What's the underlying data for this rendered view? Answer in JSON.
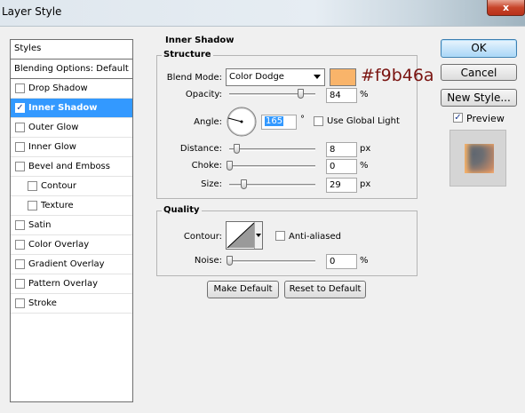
{
  "window": {
    "title": "Layer Style",
    "close_glyph": "x"
  },
  "sidebar": {
    "header": "Styles",
    "blending_options": "Blending Options: Default",
    "items": [
      {
        "label": "Drop Shadow",
        "checked": false,
        "selected": false
      },
      {
        "label": "Inner Shadow",
        "checked": true,
        "selected": true
      },
      {
        "label": "Outer Glow",
        "checked": false,
        "selected": false
      },
      {
        "label": "Inner Glow",
        "checked": false,
        "selected": false
      },
      {
        "label": "Bevel and Emboss",
        "checked": false,
        "selected": false
      },
      {
        "label": "Contour",
        "checked": false,
        "selected": false,
        "indent": true
      },
      {
        "label": "Texture",
        "checked": false,
        "selected": false,
        "indent": true
      },
      {
        "label": "Satin",
        "checked": false,
        "selected": false
      },
      {
        "label": "Color Overlay",
        "checked": false,
        "selected": false
      },
      {
        "label": "Gradient Overlay",
        "checked": false,
        "selected": false
      },
      {
        "label": "Pattern Overlay",
        "checked": false,
        "selected": false
      },
      {
        "label": "Stroke",
        "checked": false,
        "selected": false
      }
    ]
  },
  "inner_shadow": {
    "section_title": "Inner Shadow",
    "structure_title": "Structure",
    "blend_mode_label": "Blend Mode:",
    "blend_mode_value": "Color Dodge",
    "color_swatch": "#f9b46a",
    "color_annotation": "#f9b46a",
    "opacity_label": "Opacity:",
    "opacity_value": "84",
    "opacity_unit": "%",
    "angle_label": "Angle:",
    "angle_value": "165",
    "angle_unit": "°",
    "use_global_light_label": "Use Global Light",
    "use_global_light_checked": false,
    "distance_label": "Distance:",
    "distance_value": "8",
    "distance_unit": "px",
    "choke_label": "Choke:",
    "choke_value": "0",
    "choke_unit": "%",
    "size_label": "Size:",
    "size_value": "29",
    "size_unit": "px"
  },
  "quality": {
    "title": "Quality",
    "contour_label": "Contour:",
    "anti_aliased_label": "Anti-aliased",
    "anti_aliased_checked": false,
    "noise_label": "Noise:",
    "noise_value": "0",
    "noise_unit": "%"
  },
  "buttons": {
    "make_default": "Make Default",
    "reset_default": "Reset to Default",
    "ok": "OK",
    "cancel": "Cancel",
    "new_style": "New Style..."
  },
  "preview": {
    "label": "Preview",
    "checked": true
  }
}
